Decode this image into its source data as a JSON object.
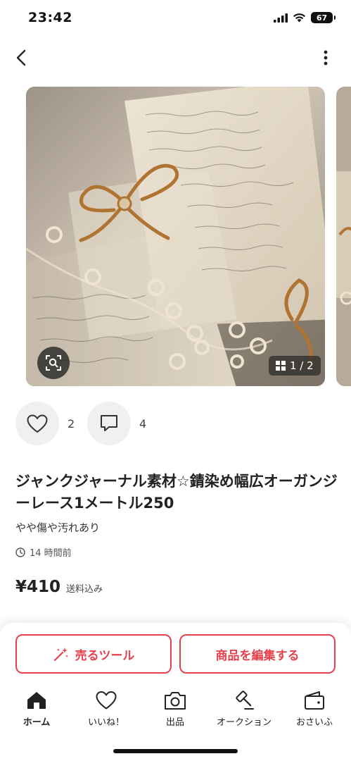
{
  "status_bar": {
    "time": "23:42",
    "battery": "67",
    "icons": [
      "signal-icon",
      "wifi-icon",
      "battery-icon"
    ]
  },
  "nav": {
    "back_icon": "chevron-left-icon",
    "more_icon": "more-vertical-icon"
  },
  "gallery": {
    "counter": "1 / 2",
    "zoom_icon": "image-search-icon"
  },
  "reactions": {
    "likes": "2",
    "comments": "4"
  },
  "product": {
    "title": "ジャンクジャーナル素材☆錆染め幅広オーガンジーレース1メートル250",
    "condition": "やや傷や汚れあり",
    "posted": "14 時間前",
    "price": "¥410",
    "shipping": "送料込み"
  },
  "actions": {
    "sell_tool": "売るツール",
    "edit_item": "商品を編集する"
  },
  "tab_bar": [
    {
      "label": "ホーム",
      "icon": "home-icon"
    },
    {
      "label": "いいね！",
      "icon": "heart-icon"
    },
    {
      "label": "出品",
      "icon": "camera-icon"
    },
    {
      "label": "オークション",
      "icon": "gavel-icon"
    },
    {
      "label": "おさいふ",
      "icon": "wallet-icon"
    }
  ],
  "colors": {
    "accent": "#e8414d",
    "text": "#222222",
    "muted_bg": "#f0f0f0"
  }
}
